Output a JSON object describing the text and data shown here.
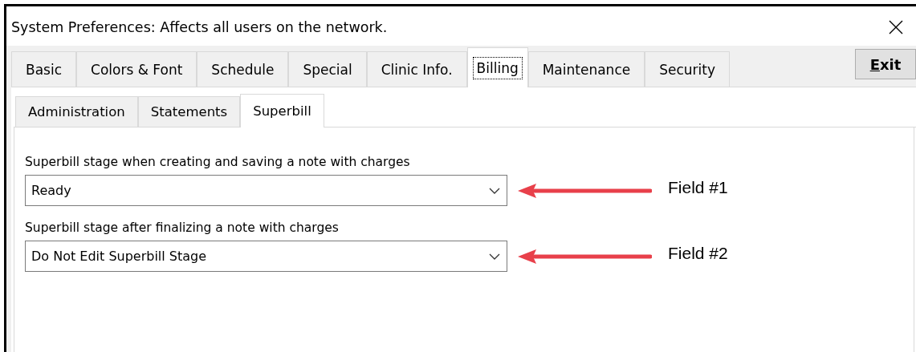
{
  "window": {
    "title": "System Preferences: Affects all users on the network."
  },
  "tabs": [
    {
      "label": "Basic",
      "selected": false,
      "focused": false
    },
    {
      "label": "Colors & Font",
      "selected": false,
      "focused": false
    },
    {
      "label": "Schedule",
      "selected": false,
      "focused": false
    },
    {
      "label": "Special",
      "selected": false,
      "focused": false
    },
    {
      "label": "Clinic Info.",
      "selected": false,
      "focused": false
    },
    {
      "label": "Billing",
      "selected": true,
      "focused": true
    },
    {
      "label": "Maintenance",
      "selected": false,
      "focused": false
    },
    {
      "label": "Security",
      "selected": false,
      "focused": false
    }
  ],
  "exit_button": {
    "label": "Exit",
    "mnemonic": true
  },
  "subtabs": [
    {
      "label": "Administration",
      "selected": false
    },
    {
      "label": "Statements",
      "selected": false
    },
    {
      "label": "Superbill",
      "selected": true
    }
  ],
  "fields": [
    {
      "label": "Superbill stage when creating and saving a note with charges",
      "value": "Ready",
      "annotation": "Field #1"
    },
    {
      "label": "Superbill stage after finalizing a note with charges",
      "value": "Do Not Edit Superbill Stage",
      "annotation": "Field #2"
    }
  ]
}
